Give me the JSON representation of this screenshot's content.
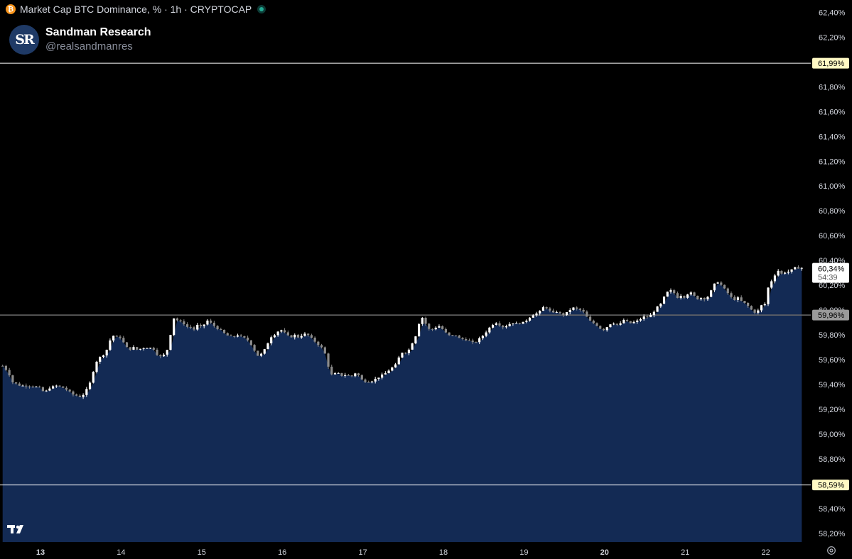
{
  "header": {
    "title": "Market Cap BTC Dominance, % · 1h · CRYPTOCAP",
    "symbol_icon": "bitcoin-icon",
    "status_icon": "market-open-dot"
  },
  "brand": {
    "name": "Sandman Research",
    "handle": "@realsandmanres",
    "logo_text": "SR"
  },
  "colors": {
    "background": "#000000",
    "area_fill": "#132a54",
    "candle_up": "#ffffff",
    "candle_down": "#8c8c8c",
    "level_line": "#ffffff",
    "level_label_bg": "#fff9c4",
    "current_label_bg": "#ffffff",
    "ref_line": "#6b6b6b"
  },
  "chart_data": {
    "type": "candlestick",
    "title": "Market Cap BTC Dominance, % · 1h · CRYPTOCAP",
    "ylim": [
      58.13,
      62.5
    ],
    "y_ticks": [
      "62,40%",
      "62,20%",
      "62,00%",
      "61,80%",
      "61,60%",
      "61,40%",
      "61,20%",
      "61,00%",
      "60,80%",
      "60,60%",
      "60,40%",
      "60,20%",
      "60,00%",
      "59,80%",
      "59,60%",
      "59,40%",
      "59,20%",
      "59,00%",
      "58,80%",
      "58,60%",
      "58,40%",
      "58,20%"
    ],
    "y_tick_values": [
      62.4,
      62.2,
      62.0,
      61.8,
      61.6,
      61.4,
      61.2,
      61.0,
      60.8,
      60.6,
      60.4,
      60.2,
      60.0,
      59.8,
      59.6,
      59.4,
      59.2,
      59.0,
      58.8,
      58.6,
      58.4,
      58.2
    ],
    "x_ticks": [
      "13",
      "14",
      "15",
      "16",
      "17",
      "18",
      "19",
      "20",
      "21",
      "22"
    ],
    "x_tick_days": [
      13,
      14,
      15,
      16,
      17,
      18,
      19,
      20,
      21,
      22
    ],
    "x_tick_bold": [
      "13",
      "20"
    ],
    "x_range_days": [
      12.53,
      22.45
    ],
    "horizontal_levels": [
      {
        "value": 61.99,
        "label": "61,99%"
      },
      {
        "value": 58.59,
        "label": "58,59%"
      }
    ],
    "reference_level": {
      "value": 59.96,
      "label": "59,96%"
    },
    "current": {
      "value": 60.34,
      "label": "60,34%",
      "countdown": "54:39"
    },
    "close_path": [
      [
        12.53,
        59.55
      ],
      [
        12.6,
        59.5
      ],
      [
        12.65,
        59.42
      ],
      [
        12.75,
        59.39
      ],
      [
        12.85,
        59.39
      ],
      [
        12.95,
        59.38
      ],
      [
        13.0,
        59.37
      ],
      [
        13.05,
        59.33
      ],
      [
        13.1,
        59.37
      ],
      [
        13.2,
        59.39
      ],
      [
        13.3,
        59.37
      ],
      [
        13.4,
        59.32
      ],
      [
        13.5,
        59.3
      ],
      [
        13.55,
        59.33
      ],
      [
        13.62,
        59.42
      ],
      [
        13.68,
        59.57
      ],
      [
        13.72,
        59.61
      ],
      [
        13.8,
        59.65
      ],
      [
        13.85,
        59.72
      ],
      [
        13.88,
        59.8
      ],
      [
        13.95,
        59.78
      ],
      [
        14.0,
        59.78
      ],
      [
        14.05,
        59.71
      ],
      [
        14.1,
        59.68
      ],
      [
        14.15,
        59.7
      ],
      [
        14.2,
        59.68
      ],
      [
        14.3,
        59.7
      ],
      [
        14.4,
        59.69
      ],
      [
        14.45,
        59.64
      ],
      [
        14.5,
        59.62
      ],
      [
        14.55,
        59.65
      ],
      [
        14.6,
        59.72
      ],
      [
        14.63,
        59.91
      ],
      [
        14.67,
        59.95
      ],
      [
        14.72,
        59.89
      ],
      [
        14.76,
        59.92
      ],
      [
        14.8,
        59.86
      ],
      [
        14.85,
        59.87
      ],
      [
        14.9,
        59.84
      ],
      [
        14.95,
        59.88
      ],
      [
        15.0,
        59.86
      ],
      [
        15.05,
        59.9
      ],
      [
        15.08,
        59.92
      ],
      [
        15.12,
        59.89
      ],
      [
        15.2,
        59.85
      ],
      [
        15.25,
        59.83
      ],
      [
        15.3,
        59.8
      ],
      [
        15.38,
        59.78
      ],
      [
        15.45,
        59.8
      ],
      [
        15.5,
        59.78
      ],
      [
        15.55,
        59.77
      ],
      [
        15.6,
        59.74
      ],
      [
        15.65,
        59.68
      ],
      [
        15.7,
        59.63
      ],
      [
        15.75,
        59.65
      ],
      [
        15.8,
        59.7
      ],
      [
        15.85,
        59.78
      ],
      [
        15.9,
        59.8
      ],
      [
        15.95,
        59.83
      ],
      [
        16.0,
        59.84
      ],
      [
        16.05,
        59.8
      ],
      [
        16.1,
        59.78
      ],
      [
        16.15,
        59.8
      ],
      [
        16.2,
        59.78
      ],
      [
        16.25,
        59.8
      ],
      [
        16.3,
        59.81
      ],
      [
        16.35,
        59.78
      ],
      [
        16.4,
        59.75
      ],
      [
        16.45,
        59.72
      ],
      [
        16.5,
        59.69
      ],
      [
        16.55,
        59.62
      ],
      [
        16.58,
        59.52
      ],
      [
        16.62,
        59.47
      ],
      [
        16.68,
        59.5
      ],
      [
        16.72,
        59.47
      ],
      [
        16.8,
        59.48
      ],
      [
        16.85,
        59.46
      ],
      [
        16.92,
        59.5
      ],
      [
        16.98,
        59.44
      ],
      [
        17.05,
        59.42
      ],
      [
        17.12,
        59.43
      ],
      [
        17.2,
        59.46
      ],
      [
        17.28,
        59.49
      ],
      [
        17.35,
        59.53
      ],
      [
        17.4,
        59.55
      ],
      [
        17.45,
        59.62
      ],
      [
        17.5,
        59.67
      ],
      [
        17.55,
        59.65
      ],
      [
        17.6,
        59.72
      ],
      [
        17.65,
        59.78
      ],
      [
        17.7,
        59.9
      ],
      [
        17.75,
        59.95
      ],
      [
        17.8,
        59.85
      ],
      [
        17.85,
        59.84
      ],
      [
        17.9,
        59.86
      ],
      [
        17.95,
        59.87
      ],
      [
        18.0,
        59.84
      ],
      [
        18.05,
        59.8
      ],
      [
        18.1,
        59.79
      ],
      [
        18.15,
        59.8
      ],
      [
        18.2,
        59.77
      ],
      [
        18.3,
        59.76
      ],
      [
        18.38,
        59.73
      ],
      [
        18.45,
        59.77
      ],
      [
        18.5,
        59.8
      ],
      [
        18.55,
        59.84
      ],
      [
        18.6,
        59.88
      ],
      [
        18.65,
        59.9
      ],
      [
        18.7,
        59.88
      ],
      [
        18.75,
        59.86
      ],
      [
        18.8,
        59.88
      ],
      [
        18.85,
        59.9
      ],
      [
        18.9,
        59.89
      ],
      [
        19.0,
        59.9
      ],
      [
        19.05,
        59.93
      ],
      [
        19.1,
        59.96
      ],
      [
        19.15,
        59.97
      ],
      [
        19.2,
        59.99
      ],
      [
        19.25,
        60.03
      ],
      [
        19.3,
        60.01
      ],
      [
        19.35,
        59.97
      ],
      [
        19.4,
        59.99
      ],
      [
        19.45,
        59.97
      ],
      [
        19.5,
        59.96
      ],
      [
        19.55,
        59.99
      ],
      [
        19.6,
        60.02
      ],
      [
        19.65,
        60.01
      ],
      [
        19.7,
        60.0
      ],
      [
        19.75,
        59.98
      ],
      [
        19.8,
        59.92
      ],
      [
        19.85,
        59.9
      ],
      [
        19.9,
        59.88
      ],
      [
        19.95,
        59.85
      ],
      [
        20.0,
        59.84
      ],
      [
        20.05,
        59.88
      ],
      [
        20.1,
        59.9
      ],
      [
        20.15,
        59.88
      ],
      [
        20.2,
        59.89
      ],
      [
        20.25,
        59.93
      ],
      [
        20.3,
        59.89
      ],
      [
        20.35,
        59.9
      ],
      [
        20.4,
        59.91
      ],
      [
        20.45,
        59.93
      ],
      [
        20.5,
        59.95
      ],
      [
        20.55,
        59.94
      ],
      [
        20.6,
        59.98
      ],
      [
        20.65,
        60.02
      ],
      [
        20.7,
        60.05
      ],
      [
        20.75,
        60.12
      ],
      [
        20.8,
        60.16
      ],
      [
        20.85,
        60.15
      ],
      [
        20.9,
        60.1
      ],
      [
        20.95,
        60.12
      ],
      [
        21.0,
        60.1
      ],
      [
        21.05,
        60.15
      ],
      [
        21.1,
        60.12
      ],
      [
        21.15,
        60.09
      ],
      [
        21.2,
        60.1
      ],
      [
        21.25,
        60.09
      ],
      [
        21.3,
        60.12
      ],
      [
        21.35,
        60.2
      ],
      [
        21.4,
        60.23
      ],
      [
        21.45,
        60.2
      ],
      [
        21.5,
        60.16
      ],
      [
        21.55,
        60.12
      ],
      [
        21.6,
        60.08
      ],
      [
        21.65,
        60.1
      ],
      [
        21.7,
        60.07
      ],
      [
        21.75,
        60.05
      ],
      [
        21.8,
        60.02
      ],
      [
        21.85,
        59.98
      ],
      [
        21.9,
        59.99
      ],
      [
        21.95,
        60.04
      ],
      [
        22.0,
        60.05
      ],
      [
        22.03,
        60.18
      ],
      [
        22.06,
        60.22
      ],
      [
        22.1,
        60.27
      ],
      [
        22.15,
        60.32
      ],
      [
        22.2,
        60.29
      ],
      [
        22.25,
        60.31
      ],
      [
        22.3,
        60.31
      ],
      [
        22.35,
        60.34
      ]
    ]
  }
}
